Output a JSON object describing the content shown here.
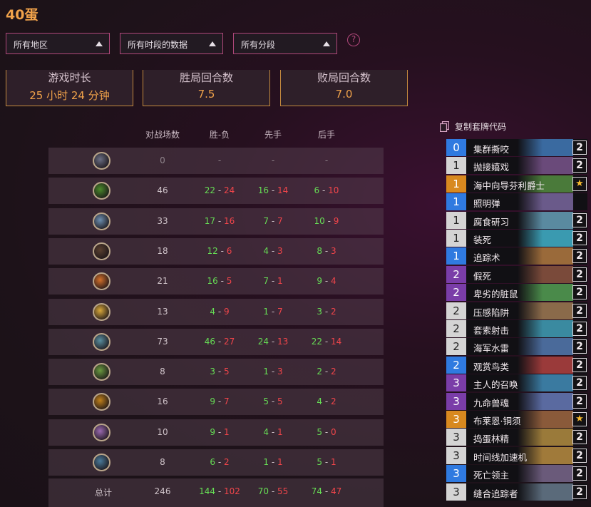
{
  "page": {
    "title": "40蛋"
  },
  "filters": [
    {
      "label": "所有地区"
    },
    {
      "label": "所有时段的数据"
    },
    {
      "label": "所有分段"
    }
  ],
  "help": {
    "symbol": "?"
  },
  "stats": [
    {
      "label": "游戏时长",
      "value": "25 小时 24 分钟"
    },
    {
      "label": "胜局回合数",
      "value": "7.5"
    },
    {
      "label": "败局回合数",
      "value": "7.0"
    }
  ],
  "table": {
    "headers": [
      "对战场数",
      "胜-负",
      "先手",
      "后手"
    ],
    "rows": [
      {
        "icon": "class-all-icon",
        "color": "#6b6f84",
        "games": "0",
        "w": "-",
        "l": "",
        "fw": "-",
        "fl": "",
        "sw": "-",
        "sl": ""
      },
      {
        "icon": "druid-icon",
        "color": "#4a8a2a",
        "games": "46",
        "w": "22",
        "l": "24",
        "fw": "16",
        "fl": "14",
        "sw": "6",
        "sl": "10"
      },
      {
        "icon": "hunter-icon",
        "color": "#6d8fb0",
        "games": "33",
        "w": "17",
        "l": "16",
        "fw": "7",
        "fl": "7",
        "sw": "10",
        "sl": "9"
      },
      {
        "icon": "mage-icon",
        "color": "#5a4030",
        "games": "18",
        "w": "12",
        "l": "6",
        "fw": "4",
        "fl": "3",
        "sw": "8",
        "sl": "3"
      },
      {
        "icon": "paladin-icon",
        "color": "#d4702a",
        "games": "21",
        "w": "16",
        "l": "5",
        "fw": "7",
        "fl": "1",
        "sw": "9",
        "sl": "4"
      },
      {
        "icon": "priest-icon",
        "color": "#d9a83a",
        "games": "13",
        "w": "4",
        "l": "9",
        "fw": "1",
        "fl": "7",
        "sw": "3",
        "sl": "2"
      },
      {
        "icon": "rogue-icon",
        "color": "#5a8fa0",
        "games": "73",
        "w": "46",
        "l": "27",
        "fw": "24",
        "fl": "13",
        "sw": "22",
        "sl": "14"
      },
      {
        "icon": "shaman-icon",
        "color": "#6a9a40",
        "games": "8",
        "w": "3",
        "l": "5",
        "fw": "1",
        "fl": "3",
        "sw": "2",
        "sl": "2"
      },
      {
        "icon": "warlock-icon",
        "color": "#c0801a",
        "games": "16",
        "w": "9",
        "l": "7",
        "fw": "5",
        "fl": "5",
        "sw": "4",
        "sl": "2"
      },
      {
        "icon": "warrior-icon",
        "color": "#9a6ab0",
        "games": "10",
        "w": "9",
        "l": "1",
        "fw": "4",
        "fl": "1",
        "sw": "5",
        "sl": "0"
      },
      {
        "icon": "demonhunter-icon",
        "color": "#4a7a9a",
        "games": "8",
        "w": "6",
        "l": "2",
        "fw": "1",
        "fl": "1",
        "sw": "5",
        "sl": "1"
      }
    ],
    "total": {
      "label": "总计",
      "games": "246",
      "w": "144",
      "l": "102",
      "fw": "70",
      "fl": "55",
      "sw": "74",
      "sl": "47"
    }
  },
  "deck": {
    "copy_label": "复制套牌代码",
    "cards": [
      {
        "cost": "0",
        "name": "集群撕咬",
        "count": "2",
        "rarity": "common",
        "art": "#3a6aa0"
      },
      {
        "cost": "1",
        "name": "抛接嬉戏",
        "count": "2",
        "rarity": "free",
        "art": "#6a4a7a"
      },
      {
        "cost": "1",
        "name": "海中向导芬利爵士",
        "count": "★",
        "rarity": "legendary",
        "art": "#4a7a3a"
      },
      {
        "cost": "1",
        "name": "照明弹",
        "count": "",
        "rarity": "rare",
        "art": "#6a5a8a"
      },
      {
        "cost": "1",
        "name": "腐食研习",
        "count": "2",
        "rarity": "free",
        "art": "#5a8aa0"
      },
      {
        "cost": "1",
        "name": "装死",
        "count": "2",
        "rarity": "free",
        "art": "#3a9ab0"
      },
      {
        "cost": "1",
        "name": "追踪术",
        "count": "2",
        "rarity": "rare",
        "art": "#9a6a3a"
      },
      {
        "cost": "2",
        "name": "假死",
        "count": "2",
        "rarity": "epic",
        "art": "#7a4a3a"
      },
      {
        "cost": "2",
        "name": "卑劣的脏鼠",
        "count": "2",
        "rarity": "epic",
        "art": "#4a8a4a"
      },
      {
        "cost": "2",
        "name": "压感陷阱",
        "count": "2",
        "rarity": "free",
        "art": "#8a6a4a"
      },
      {
        "cost": "2",
        "name": "套索射击",
        "count": "2",
        "rarity": "free",
        "art": "#3a8aa0"
      },
      {
        "cost": "2",
        "name": "海军水雷",
        "count": "2",
        "rarity": "free",
        "art": "#4a6a9a"
      },
      {
        "cost": "2",
        "name": "观赏鸟类",
        "count": "2",
        "rarity": "rare",
        "art": "#9a3a3a"
      },
      {
        "cost": "3",
        "name": "主人的召唤",
        "count": "2",
        "rarity": "epic",
        "art": "#3a7aa0"
      },
      {
        "cost": "3",
        "name": "九命兽魂",
        "count": "2",
        "rarity": "epic",
        "art": "#5a6aa0"
      },
      {
        "cost": "3",
        "name": "布莱恩·铜须",
        "count": "★",
        "rarity": "legendary",
        "art": "#8a5a3a"
      },
      {
        "cost": "3",
        "name": "捣蛋林精",
        "count": "2",
        "rarity": "free",
        "art": "#9a7a3a"
      },
      {
        "cost": "3",
        "name": "时间线加速机",
        "count": "2",
        "rarity": "free",
        "art": "#a07a3a"
      },
      {
        "cost": "3",
        "name": "死亡领主",
        "count": "2",
        "rarity": "rare",
        "art": "#6a5a7a"
      },
      {
        "cost": "3",
        "name": "缝合追踪者",
        "count": "2",
        "rarity": "free",
        "art": "#5a6a7a"
      }
    ]
  },
  "colors": {
    "accent": "#f0a24a",
    "filter_border": "#b0477a",
    "win": "#66dd55",
    "loss": "#f0454a",
    "rarity_free": "#d4d4d4",
    "rarity_common": "#2f7ae0",
    "rarity_rare": "#2f7ae0",
    "rarity_epic": "#7a3da8",
    "rarity_legendary": "#d8891f"
  }
}
